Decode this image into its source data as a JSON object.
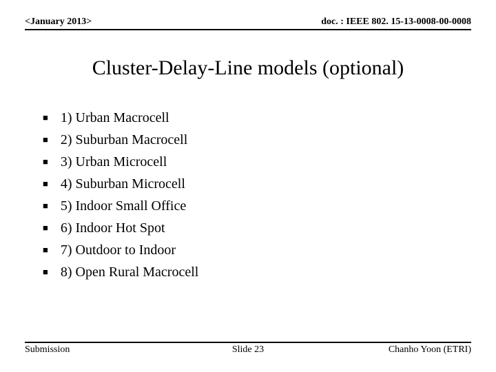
{
  "header": {
    "left": "<January 2013>",
    "right": "doc. : IEEE 802. 15-13-0008-00-0008"
  },
  "title": "Cluster-Delay-Line models (optional)",
  "bullets": [
    "1) Urban Macrocell",
    "2) Suburban Macrocell",
    "3) Urban Microcell",
    "4) Suburban Microcell",
    "5) Indoor Small Office",
    "6) Indoor Hot Spot",
    "7) Outdoor to Indoor",
    "8) Open Rural Macrocell"
  ],
  "footer": {
    "left": "Submission",
    "center": "Slide 23",
    "right": "Chanho Yoon (ETRI)"
  }
}
